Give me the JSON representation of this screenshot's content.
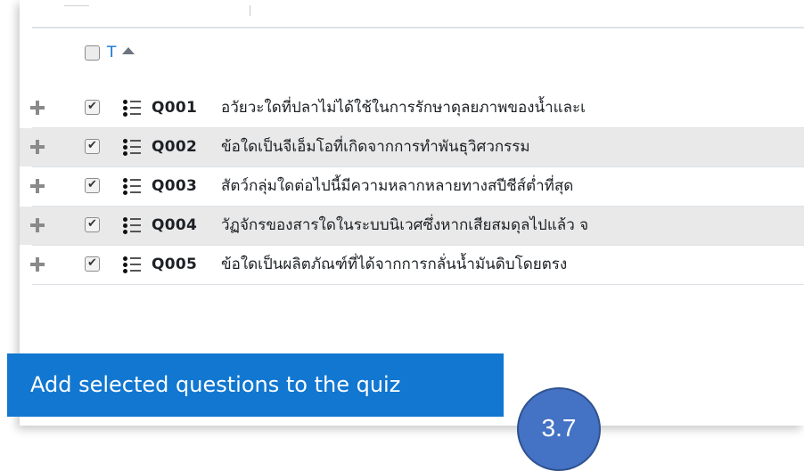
{
  "table": {
    "sort_column_label": "T",
    "rows": [
      {
        "name": "Q001",
        "text": "อวัยวะใดที่ปลาไม่ได้ใช้ในการรักษาดุลยภาพของน้ำและเ"
      },
      {
        "name": "Q002",
        "text": "ข้อใดเป็นจีเอ็มโอที่เกิดจากการทำพันธุวิศวกรรม"
      },
      {
        "name": "Q003",
        "text": "สัตว์กลุ่มใดต่อไปนี้มีความหลากหลายทางสปีชีส์ต่ำที่สุด"
      },
      {
        "name": "Q004",
        "text": "วัฏจักรของสารใดในระบบนิเวศซึ่งหากเสียสมดุลไปแล้ว จ"
      },
      {
        "name": "Q005",
        "text": "ข้อใดเป็นผลิตภัณฑ์ที่ได้จากการกลั่นน้ำมันดิบโดยตรง"
      }
    ]
  },
  "actions": {
    "add_selected_label": "Add selected questions to the quiz"
  },
  "badge": {
    "label": "3.7"
  },
  "colors": {
    "accent": "#1177d1",
    "badge": "#4472c4",
    "alt_row": "#e9e9e9"
  },
  "icons": {
    "add": "plus-icon",
    "question_type": "multichoice-list-icon",
    "sort": "caret-up-icon"
  }
}
